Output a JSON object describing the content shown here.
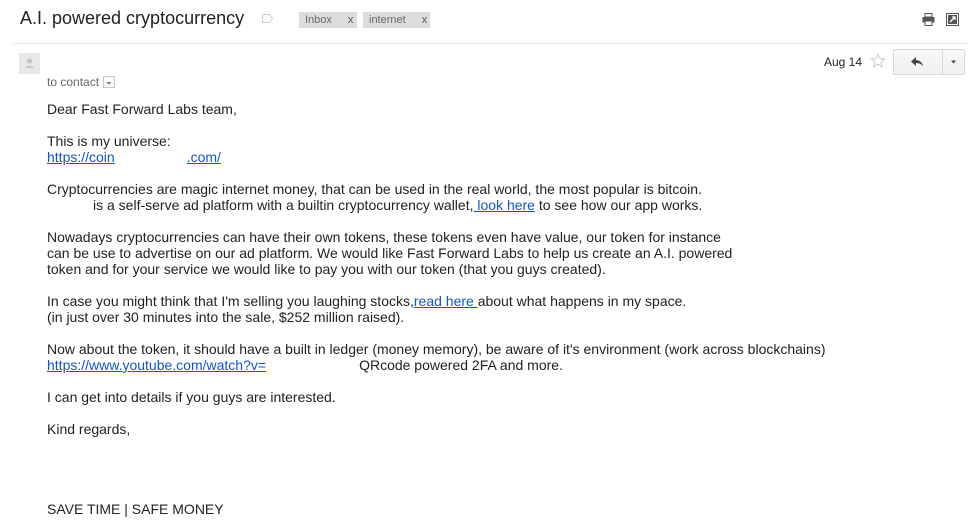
{
  "header": {
    "subject": "A.I. powered cryptocurrency",
    "labels": [
      {
        "name": "Inbox",
        "remove": "x"
      },
      {
        "name": "internet",
        "remove": "x"
      }
    ],
    "icons": [
      "label-tag-icon",
      "print-icon",
      "new-window-icon"
    ]
  },
  "message": {
    "date": "Aug 14",
    "to": "to contact",
    "icons": [
      "avatar-icon",
      "star-icon",
      "reply-icon",
      "more-dropdown-icon"
    ]
  },
  "body": {
    "greeting": "Dear Fast Forward Labs team,",
    "universe_intro": "This is my universe:",
    "universe_link_start": "https://coin",
    "universe_link_end": ".com/",
    "p1_line1": "Cryptocurrencies are magic internet money, that can be used in the real world, the most popular is bitcoin.",
    "p1_line2_pre": "is a self-serve ad platform with a builtin cryptocurrency wallet,",
    "p1_line2_link": " look here",
    "p1_line2_post": " to see how our app works.",
    "p2_line1": "Nowadays cryptocurrencies can have their own tokens, these tokens even have value, our token for instance",
    "p2_line2": "can be use to advertise on our ad platform. We would like Fast Forward Labs to help us create an A.I. powered",
    "p2_line3": "token and for your service we would like to pay you with our token (that you guys created).",
    "p3_line1_pre": "In case you might think that I'm selling you laughing stocks,",
    "p3_line1_link": "read here ",
    "p3_line1_post": "about what happens in my space.",
    "p3_line2": "(in just over 30 minutes into the sale, $252 million raised).",
    "p4_line1": "Now about the token, it should have a built in ledger (money memory), be aware of it's environment (work across blockchains)",
    "p4_link": "https://www.youtube.com/watch?v=",
    "p4_line2_post": "QRcode powered 2FA and more.",
    "p5": "I can get into details if you guys are interested.",
    "closing": "Kind regards,",
    "signature": "SAVE TIME | SAFE MONEY"
  },
  "colors": {
    "link": "#1155cc",
    "text": "#222222",
    "label_bg": "#dddddd"
  }
}
